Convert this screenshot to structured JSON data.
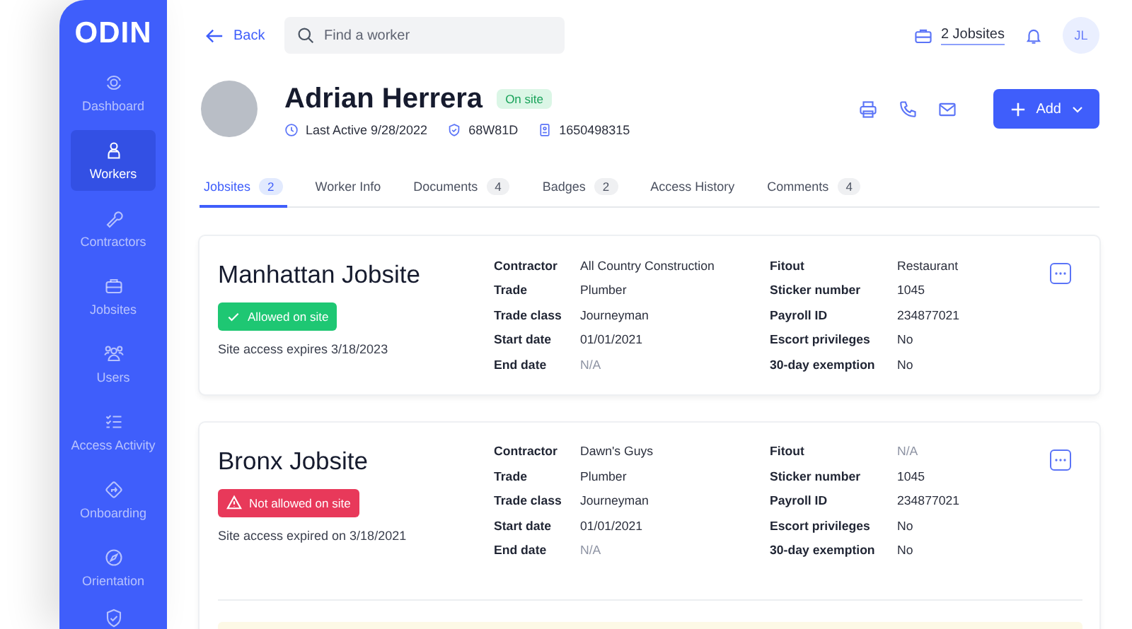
{
  "sidebar": {
    "logo": "ODIN",
    "items": [
      {
        "label": "Dashboard",
        "selected": false
      },
      {
        "label": "Workers",
        "selected": true
      },
      {
        "label": "Contractors",
        "selected": false
      },
      {
        "label": "Jobsites",
        "selected": false
      },
      {
        "label": "Users",
        "selected": false
      },
      {
        "label": "Access Activity",
        "selected": false
      },
      {
        "label": "Onboarding",
        "selected": false
      },
      {
        "label": "Orientation",
        "selected": false
      }
    ]
  },
  "topbar": {
    "back": "Back",
    "search": {
      "placeholder": "Find a worker"
    },
    "jobsites": "2 Jobsites",
    "avatar": "JL"
  },
  "worker": {
    "name": "Adrian Herrera",
    "status": "On site",
    "last_active": "Last Active 9/28/2022",
    "badge_id": "68W81D",
    "card_id": "1650498315"
  },
  "add_button": "Add",
  "tabs": [
    {
      "label": "Jobsites",
      "count": "2",
      "selected": true
    },
    {
      "label": "Worker Info",
      "selected": false
    },
    {
      "label": "Documents",
      "count": "4",
      "selected": false
    },
    {
      "label": "Badges",
      "count": "2",
      "selected": false
    },
    {
      "label": "Access History",
      "selected": false
    },
    {
      "label": "Comments",
      "count": "4",
      "selected": false
    }
  ],
  "jobsites": [
    {
      "name": "Manhattan Jobsite",
      "access": {
        "kind": "allowed",
        "label": "Allowed on site"
      },
      "expiry": "Site access expires 3/18/2023",
      "notice": false,
      "rows": [
        {
          "label": "Contractor",
          "value": "All Country Construction",
          "muted": false,
          "label2": "Fitout",
          "value2": "Restaurant",
          "muted2": false
        },
        {
          "label": "Trade",
          "value": "Plumber",
          "muted": false,
          "label2": "Sticker number",
          "value2": "1045",
          "muted2": false
        },
        {
          "label": "Trade class",
          "value": "Journeyman",
          "muted": false,
          "label2": "Payroll ID",
          "value2": "234877021",
          "muted2": false
        },
        {
          "label": "Start date",
          "value": "01/01/2021",
          "muted": false,
          "label2": "Escort privileges",
          "value2": "No",
          "muted2": false
        },
        {
          "label": "End date",
          "value": "N/A",
          "muted": true,
          "label2": "30-day exemption",
          "value2": "No",
          "muted2": false
        }
      ]
    },
    {
      "name": "Bronx Jobsite",
      "access": {
        "kind": "denied",
        "label": "Not allowed on site"
      },
      "expiry": "Site access expired on 3/18/2021",
      "notice": true,
      "rows": [
        {
          "label": "Contractor",
          "value": "Dawn's Guys",
          "muted": false,
          "label2": "Fitout",
          "value2": "N/A",
          "muted2": true
        },
        {
          "label": "Trade",
          "value": "Plumber",
          "muted": false,
          "label2": "Sticker number",
          "value2": "1045",
          "muted2": false
        },
        {
          "label": "Trade class",
          "value": "Journeyman",
          "muted": false,
          "label2": "Payroll ID",
          "value2": "234877021",
          "muted2": false
        },
        {
          "label": "Start date",
          "value": "01/01/2021",
          "muted": false,
          "label2": "Escort privileges",
          "value2": "No",
          "muted2": false
        },
        {
          "label": "End date",
          "value": "N/A",
          "muted": true,
          "label2": "30-day exemption",
          "value2": "No",
          "muted2": false
        }
      ]
    }
  ]
}
